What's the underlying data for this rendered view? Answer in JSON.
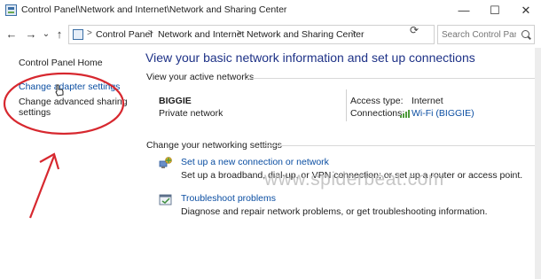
{
  "window": {
    "title": "Control Panel\\Network and Internet\\Network and Sharing Center",
    "minimize": "—",
    "maximize": "☐",
    "close": "✕"
  },
  "nav": {
    "back": "←",
    "forward": "→",
    "recent": "⌄",
    "up": "↑",
    "breadcrumbs": [
      "Control Panel",
      "Network and Internet",
      "Network and Sharing Center"
    ],
    "separator": ">",
    "refresh": "⟳",
    "search_placeholder": "Search Control Panel"
  },
  "sidebar": {
    "items": [
      {
        "label": "Control Panel Home"
      },
      {
        "label": "Change adapter settings"
      },
      {
        "label_line1": "Change advanced sharing",
        "label_line2": "settings"
      }
    ]
  },
  "main": {
    "heading": "View your basic network information and set up connections",
    "active_networks_title": "View your active networks",
    "network": {
      "name": "BIGGIE",
      "type": "Private network",
      "access_type_label": "Access type:",
      "access_type_value": "Internet",
      "connections_label": "Connections:",
      "connections_value": "Wi-Fi (BIGGIE)"
    },
    "change_settings_title": "Change your networking settings",
    "tasks": [
      {
        "icon": "network-setup-icon",
        "link": "Set up a new connection or network",
        "desc": "Set up a broadband, dial-up, or VPN connection; or set up a router or access point."
      },
      {
        "icon": "troubleshoot-icon",
        "link": "Troubleshoot problems",
        "desc": "Diagnose and repair network problems, or get troubleshooting information."
      }
    ]
  },
  "watermark": "www.spiderbeat.com",
  "colors": {
    "link": "#0b4ea2",
    "heading": "#1e3287",
    "annotation": "#d7282f",
    "wifi": "#4f9a3c"
  }
}
